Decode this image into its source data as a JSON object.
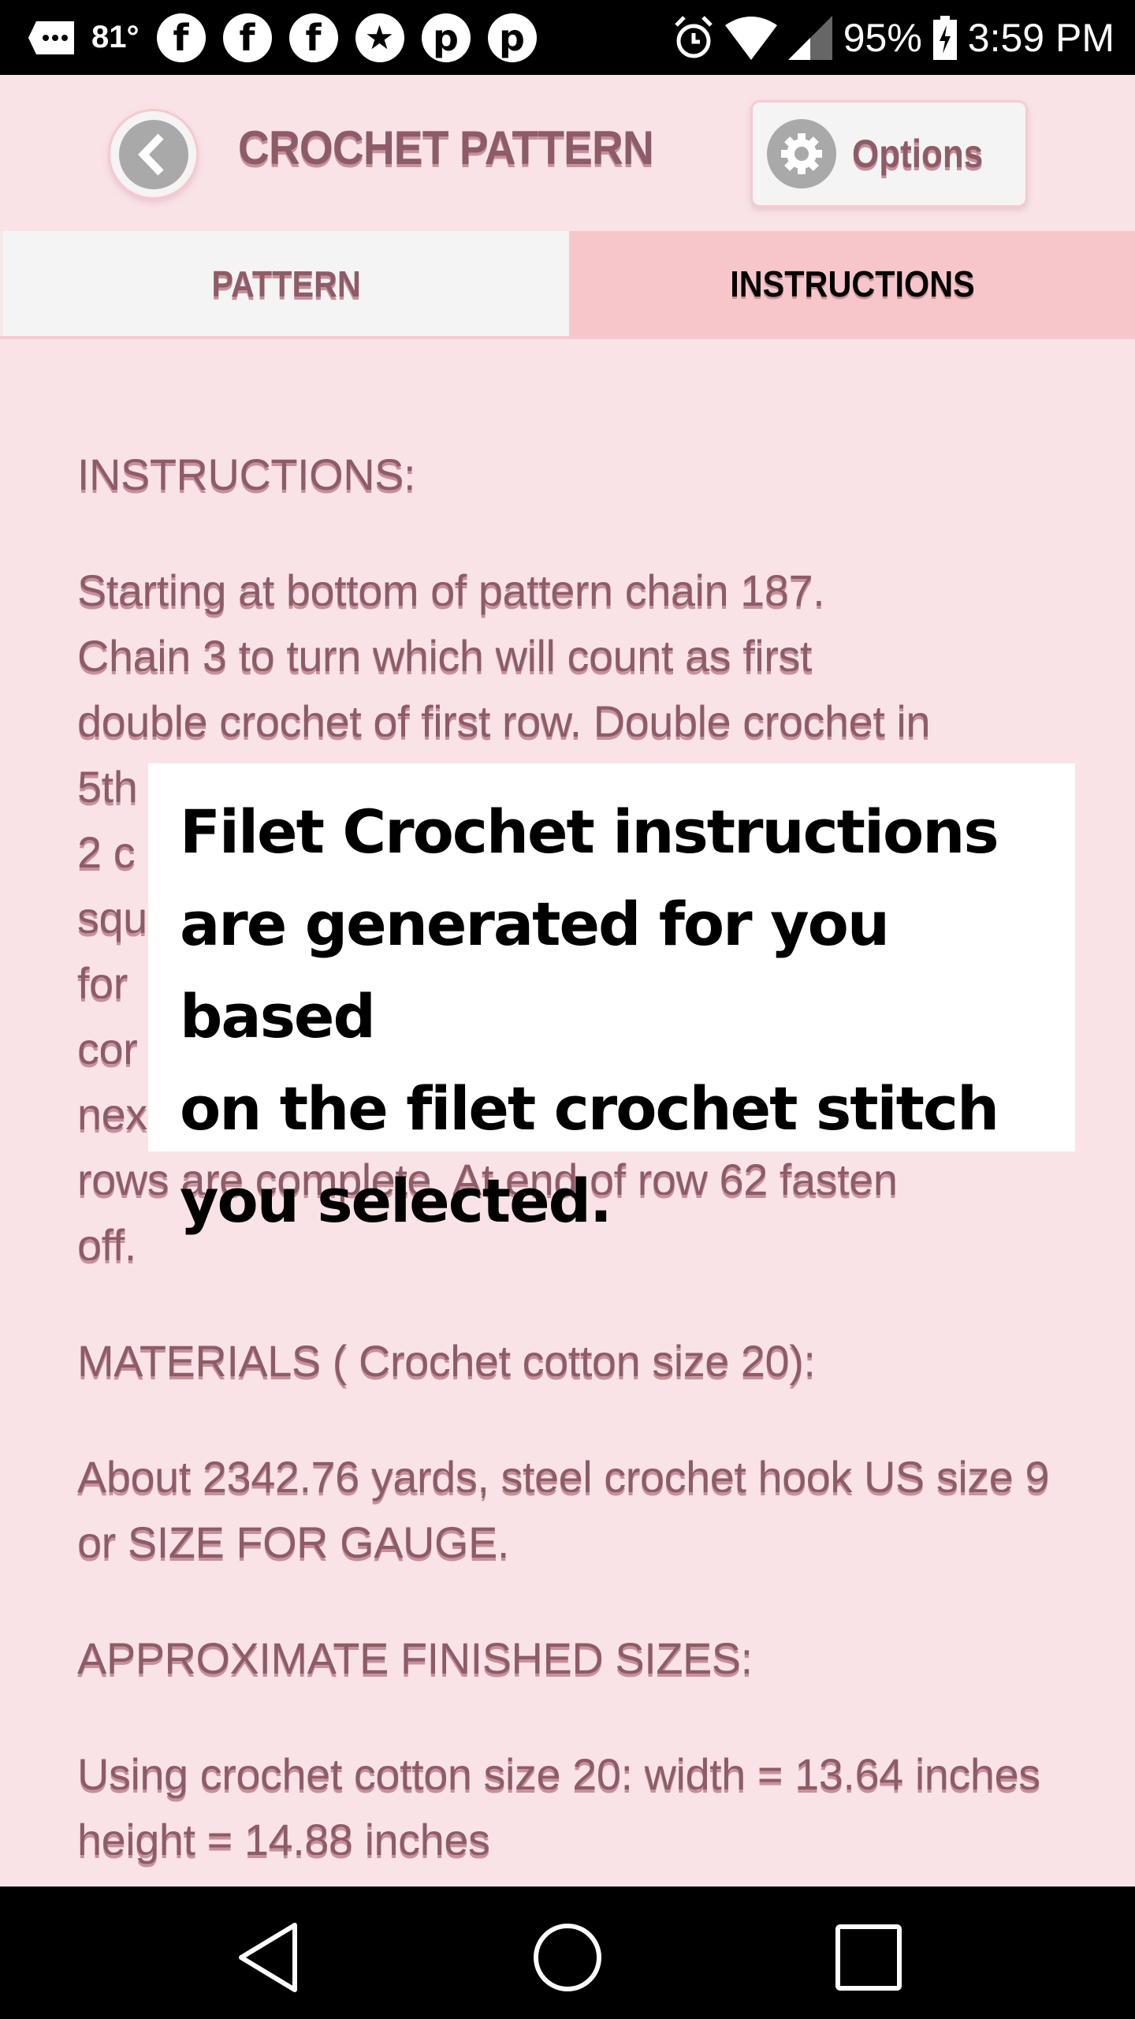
{
  "status_bar": {
    "temperature": "81°",
    "notification_icons": [
      "messages-icon",
      "facebook-icon",
      "facebook-icon",
      "facebook-icon",
      "star-icon",
      "pinterest-icon",
      "pinterest-icon"
    ],
    "battery": "95%",
    "time": "3:59 PM"
  },
  "header": {
    "title": "CROCHET PATTERN",
    "back_icon": "chevron-left-icon",
    "options_label": "Options",
    "options_icon": "gear-icon"
  },
  "tabs": [
    {
      "label": "PATTERN",
      "active": false
    },
    {
      "label": "INSTRUCTIONS",
      "active": true
    }
  ],
  "content": {
    "instructions_heading": "INSTRUCTIONS:",
    "instructions_visible_lines": [
      "Starting at bottom of pattern chain 187.",
      "Chain 3 to turn which will count as first",
      "double crochet of first row. Double crochet in",
      "5th",
      "2 c",
      "squ",
      "for",
      "cor",
      "nex",
      "rows are complete. At end of row 62 fasten",
      "off."
    ],
    "materials_heading": "MATERIALS ( Crochet cotton size 20):",
    "materials_text": "About 2342.76 yards, steel crochet hook US size 9 or SIZE FOR GAUGE.",
    "sizes_heading": "APPROXIMATE FINISHED SIZES:",
    "sizes_text": "Using crochet cotton size 20: width = 13.64 inches height = 14.88 inches"
  },
  "overlay_caption": {
    "lines": [
      "Filet Crochet instructions",
      "are generated for you based",
      "on the filet crochet stitch",
      "you selected."
    ]
  },
  "colors": {
    "background": "#f9e3e6",
    "text": "#8d5c66",
    "active_tab": "#f6c6cb",
    "inactive_tab": "#f5f4f4",
    "icon_circle": "#a9a9a9"
  }
}
